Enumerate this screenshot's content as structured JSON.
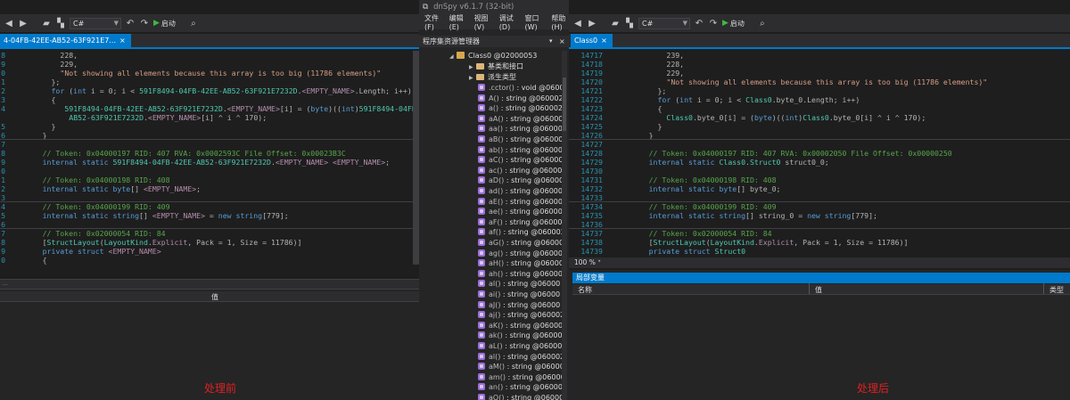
{
  "left": {
    "toolbar": {
      "language": "C#",
      "run_label": "启动"
    },
    "tab": {
      "title": "4-04FB-42EE-AB52-63F921E7...",
      "close": "×"
    },
    "code_lines": [
      {
        "ln": "8",
        "indent": 12,
        "parts": [
          [
            "pu",
            "228,"
          ]
        ]
      },
      {
        "ln": "9",
        "indent": 12,
        "parts": [
          [
            "pu",
            "229,"
          ]
        ]
      },
      {
        "ln": "0",
        "indent": 12,
        "parts": [
          [
            "str",
            "\"Not showing all elements because this array is too big (11786 elements)\""
          ]
        ]
      },
      {
        "ln": "1",
        "indent": 10,
        "parts": [
          [
            "pu",
            "};"
          ]
        ]
      },
      {
        "ln": "2",
        "indent": 10,
        "parts": [
          [
            "kw",
            "for "
          ],
          [
            "pu",
            "("
          ],
          [
            "kw",
            "int"
          ],
          [
            "pu",
            " i = 0; i < "
          ],
          [
            "ty",
            "591F8494-04FB-42EE-AB52-63F921E7232D"
          ],
          [
            "pu",
            "."
          ],
          [
            "purple",
            "<EMPTY_NAME>"
          ],
          [
            "pu",
            ".Length; i++)"
          ]
        ]
      },
      {
        "ln": "3",
        "indent": 10,
        "parts": [
          [
            "pu",
            "{"
          ]
        ]
      },
      {
        "ln": "4",
        "indent": 13,
        "parts": [
          [
            "ty",
            "591F8494-04FB-42EE-AB52-63F921E7232D"
          ],
          [
            "pu",
            "."
          ],
          [
            "purple",
            "<EMPTY_NAME>"
          ],
          [
            "pu",
            "[i] = ("
          ],
          [
            "kw",
            "byte"
          ],
          [
            "pu",
            ")(("
          ],
          [
            "kw",
            "int"
          ],
          [
            "pu",
            ")"
          ],
          [
            "ty",
            "591F8494-04FB"
          ]
        ]
      },
      {
        "ln": "",
        "indent": 14,
        "parts": [
          [
            "ty",
            "AB52-63F921E7232D"
          ],
          [
            "pu",
            "."
          ],
          [
            "purple",
            "<EMPTY_NAME>"
          ],
          [
            "pu",
            "[i] ^ i ^ 170);"
          ]
        ]
      },
      {
        "ln": "5",
        "indent": 10,
        "parts": [
          [
            "pu",
            "}"
          ]
        ]
      },
      {
        "ln": "6",
        "indent": 8,
        "parts": [
          [
            "pu",
            "}"
          ]
        ]
      },
      {
        "ln": "7",
        "indent": 0,
        "parts": []
      },
      {
        "ln": "8",
        "indent": 8,
        "parts": [
          [
            "cm",
            "// Token: 0x04000197 RID: 407 RVA: 0x0002593C File Offset: 0x00023B3C"
          ]
        ]
      },
      {
        "ln": "9",
        "indent": 8,
        "parts": [
          [
            "kw",
            "internal static "
          ],
          [
            "ty",
            "591F8494-04FB-42EE-AB52-63F921E7232D"
          ],
          [
            "pu",
            "."
          ],
          [
            "purple",
            "<EMPTY_NAME>"
          ],
          [
            "pu",
            " "
          ],
          [
            "purple",
            "<EMPTY_NAME>"
          ],
          [
            "pu",
            ";"
          ]
        ]
      },
      {
        "ln": "0",
        "indent": 0,
        "parts": []
      },
      {
        "ln": "1",
        "indent": 8,
        "parts": [
          [
            "cm",
            "// Token: 0x04000198 RID: 408"
          ]
        ]
      },
      {
        "ln": "2",
        "indent": 8,
        "parts": [
          [
            "kw",
            "internal static byte"
          ],
          [
            "pu",
            "[] "
          ],
          [
            "purple",
            "<EMPTY_NAME>"
          ],
          [
            "pu",
            ";"
          ]
        ]
      },
      {
        "ln": "3",
        "indent": 0,
        "parts": []
      },
      {
        "ln": "4",
        "indent": 8,
        "parts": [
          [
            "cm",
            "// Token: 0x04000199 RID: 409"
          ]
        ]
      },
      {
        "ln": "5",
        "indent": 8,
        "parts": [
          [
            "kw",
            "internal static string"
          ],
          [
            "pu",
            "[] "
          ],
          [
            "purple",
            "<EMPTY_NAME>"
          ],
          [
            "pu",
            " = "
          ],
          [
            "kw",
            "new string"
          ],
          [
            "pu",
            "[779];"
          ]
        ]
      },
      {
        "ln": "6",
        "indent": 0,
        "parts": []
      },
      {
        "ln": "7",
        "indent": 8,
        "parts": [
          [
            "cm",
            "// Token: 0x02000054 RID: 84"
          ]
        ]
      },
      {
        "ln": "8",
        "indent": 8,
        "parts": [
          [
            "pu",
            "["
          ],
          [
            "ty",
            "StructLayout"
          ],
          [
            "pu",
            "("
          ],
          [
            "ty",
            "LayoutKind"
          ],
          [
            "pu",
            "."
          ],
          [
            "purple",
            "Explicit"
          ],
          [
            "pu",
            ", Pack = 1, Size = 11786)]"
          ]
        ]
      },
      {
        "ln": "9",
        "indent": 8,
        "parts": [
          [
            "kw",
            "private struct "
          ],
          [
            "purple",
            "<EMPTY_NAME>"
          ]
        ]
      },
      {
        "ln": "0",
        "indent": 8,
        "parts": [
          [
            "pu",
            "{"
          ]
        ]
      }
    ],
    "panel_header": "值",
    "caption": "处理前"
  },
  "tree": {
    "window_title": "dnSpy v6.1.7 (32-bit)",
    "menu": [
      "文件(F)",
      "编辑(E)",
      "视图(V)",
      "调试(D)",
      "窗口(W)",
      "帮助(H)"
    ],
    "panel_title": "程序集资源管理器",
    "class_node": "Class0 @02000053",
    "folders": [
      "基类和接口",
      "派生类型"
    ],
    "members": [
      {
        "name": ".cctor()",
        "type": "void",
        "tok": "@0600"
      },
      {
        "name": "A()",
        "type": "string",
        "tok": "@060002"
      },
      {
        "name": "a()",
        "type": "string",
        "tok": "@060002"
      },
      {
        "name": "aA()",
        "type": "string",
        "tok": "@06000"
      },
      {
        "name": "aa()",
        "type": "string",
        "tok": "@06000"
      },
      {
        "name": "aB()",
        "type": "string",
        "tok": "@06000"
      },
      {
        "name": "ab()",
        "type": "string",
        "tok": "@06000"
      },
      {
        "name": "aC()",
        "type": "string",
        "tok": "@06000"
      },
      {
        "name": "ac()",
        "type": "string",
        "tok": "@06000"
      },
      {
        "name": "aD()",
        "type": "string",
        "tok": "@06000"
      },
      {
        "name": "ad()",
        "type": "string",
        "tok": "@06000"
      },
      {
        "name": "aE()",
        "type": "string",
        "tok": "@06000"
      },
      {
        "name": "ae()",
        "type": "string",
        "tok": "@06000"
      },
      {
        "name": "aF()",
        "type": "string",
        "tok": "@06000"
      },
      {
        "name": "af()",
        "type": "string",
        "tok": "@060002"
      },
      {
        "name": "aG()",
        "type": "string",
        "tok": "@06000"
      },
      {
        "name": "ag()",
        "type": "string",
        "tok": "@06000"
      },
      {
        "name": "aH()",
        "type": "string",
        "tok": "@06000"
      },
      {
        "name": "ah()",
        "type": "string",
        "tok": "@06000"
      },
      {
        "name": "aI()",
        "type": "string",
        "tok": "@06000"
      },
      {
        "name": "ai()",
        "type": "string",
        "tok": "@06000"
      },
      {
        "name": "aJ()",
        "type": "string",
        "tok": "@06000"
      },
      {
        "name": "aj()",
        "type": "string",
        "tok": "@060002"
      },
      {
        "name": "aK()",
        "type": "string",
        "tok": "@06000"
      },
      {
        "name": "ak()",
        "type": "string",
        "tok": "@06000"
      },
      {
        "name": "aL()",
        "type": "string",
        "tok": "@06000"
      },
      {
        "name": "al()",
        "type": "string",
        "tok": "@060002"
      },
      {
        "name": "aM()",
        "type": "string",
        "tok": "@06000"
      },
      {
        "name": "am()",
        "type": "string",
        "tok": "@06000"
      },
      {
        "name": "an()",
        "type": "string",
        "tok": "@06000"
      },
      {
        "name": "aO()",
        "type": "string",
        "tok": "@06000"
      }
    ]
  },
  "right": {
    "toolbar": {
      "language": "C#",
      "run_label": "启动"
    },
    "tab": {
      "title": "Class0",
      "close": "×"
    },
    "code_lines": [
      {
        "ln": "14717",
        "indent": 12,
        "parts": [
          [
            "pu",
            "239,"
          ]
        ]
      },
      {
        "ln": "14718",
        "indent": 12,
        "parts": [
          [
            "pu",
            "228,"
          ]
        ]
      },
      {
        "ln": "14719",
        "indent": 12,
        "parts": [
          [
            "pu",
            "229,"
          ]
        ]
      },
      {
        "ln": "14720",
        "indent": 12,
        "parts": [
          [
            "str",
            "\"Not showing all elements because this array is too big (11786 elements)\""
          ]
        ]
      },
      {
        "ln": "14721",
        "indent": 10,
        "parts": [
          [
            "pu",
            "};"
          ]
        ]
      },
      {
        "ln": "14722",
        "indent": 10,
        "parts": [
          [
            "kw",
            "for "
          ],
          [
            "pu",
            "("
          ],
          [
            "kw",
            "int"
          ],
          [
            "pu",
            " i = 0; i < "
          ],
          [
            "ty",
            "Class0"
          ],
          [
            "pu",
            ".byte_0.Length; i++)"
          ]
        ]
      },
      {
        "ln": "14723",
        "indent": 10,
        "parts": [
          [
            "pu",
            "{"
          ]
        ]
      },
      {
        "ln": "14724",
        "indent": 12,
        "parts": [
          [
            "ty",
            "Class0"
          ],
          [
            "pu",
            ".byte_0[i] = ("
          ],
          [
            "kw",
            "byte"
          ],
          [
            "pu",
            ")(("
          ],
          [
            "kw",
            "int"
          ],
          [
            "pu",
            ")"
          ],
          [
            "ty",
            "Class0"
          ],
          [
            "pu",
            ".byte_0[i] ^ i ^ 170);"
          ]
        ]
      },
      {
        "ln": "14725",
        "indent": 10,
        "parts": [
          [
            "pu",
            "}"
          ]
        ]
      },
      {
        "ln": "14726",
        "indent": 8,
        "parts": [
          [
            "pu",
            "}"
          ]
        ]
      },
      {
        "ln": "14727",
        "indent": 0,
        "parts": []
      },
      {
        "ln": "14728",
        "indent": 8,
        "parts": [
          [
            "cm",
            "// Token: 0x04000197 RID: 407 RVA: 0x00002050 File Offset: 0x00000250"
          ]
        ]
      },
      {
        "ln": "14729",
        "indent": 8,
        "parts": [
          [
            "kw",
            "internal static "
          ],
          [
            "ty",
            "Class0"
          ],
          [
            "pu",
            "."
          ],
          [
            "ty",
            "Struct0"
          ],
          [
            "pu",
            " struct0_0;"
          ]
        ]
      },
      {
        "ln": "14730",
        "indent": 0,
        "parts": []
      },
      {
        "ln": "14731",
        "indent": 8,
        "parts": [
          [
            "cm",
            "// Token: 0x04000198 RID: 408"
          ]
        ]
      },
      {
        "ln": "14732",
        "indent": 8,
        "parts": [
          [
            "kw",
            "internal static byte"
          ],
          [
            "pu",
            "[] byte_0;"
          ]
        ]
      },
      {
        "ln": "14733",
        "indent": 0,
        "parts": []
      },
      {
        "ln": "14734",
        "indent": 8,
        "parts": [
          [
            "cm",
            "// Token: 0x04000199 RID: 409"
          ]
        ]
      },
      {
        "ln": "14735",
        "indent": 8,
        "parts": [
          [
            "kw",
            "internal static string"
          ],
          [
            "pu",
            "[] string_0 = "
          ],
          [
            "kw",
            "new string"
          ],
          [
            "pu",
            "[779];"
          ]
        ]
      },
      {
        "ln": "14736",
        "indent": 0,
        "parts": []
      },
      {
        "ln": "14737",
        "indent": 8,
        "parts": [
          [
            "cm",
            "// Token: 0x02000054 RID: 84"
          ]
        ]
      },
      {
        "ln": "14738",
        "indent": 8,
        "parts": [
          [
            "pu",
            "["
          ],
          [
            "ty",
            "StructLayout"
          ],
          [
            "pu",
            "("
          ],
          [
            "ty",
            "LayoutKind"
          ],
          [
            "pu",
            "."
          ],
          [
            "purple",
            "Explicit"
          ],
          [
            "pu",
            ", Pack = 1, Size = 11786)]"
          ]
        ]
      },
      {
        "ln": "14739",
        "indent": 8,
        "parts": [
          [
            "kw",
            "private struct "
          ],
          [
            "ty",
            "Struct0"
          ]
        ]
      },
      {
        "ln": "14740",
        "indent": 8,
        "parts": [
          [
            "pu",
            "{"
          ]
        ]
      }
    ],
    "zoom": "100 %",
    "locals_title": "局部变量",
    "locals_columns": [
      "名称",
      "值",
      "类型"
    ],
    "caption": "处理后"
  },
  "colors": {
    "background": "#1e1e1e",
    "accent": "#007acc",
    "keyword": "#569cd6",
    "type": "#4ec9b0",
    "string": "#d69d85",
    "comment": "#57a64a",
    "caption": "#e02020"
  }
}
